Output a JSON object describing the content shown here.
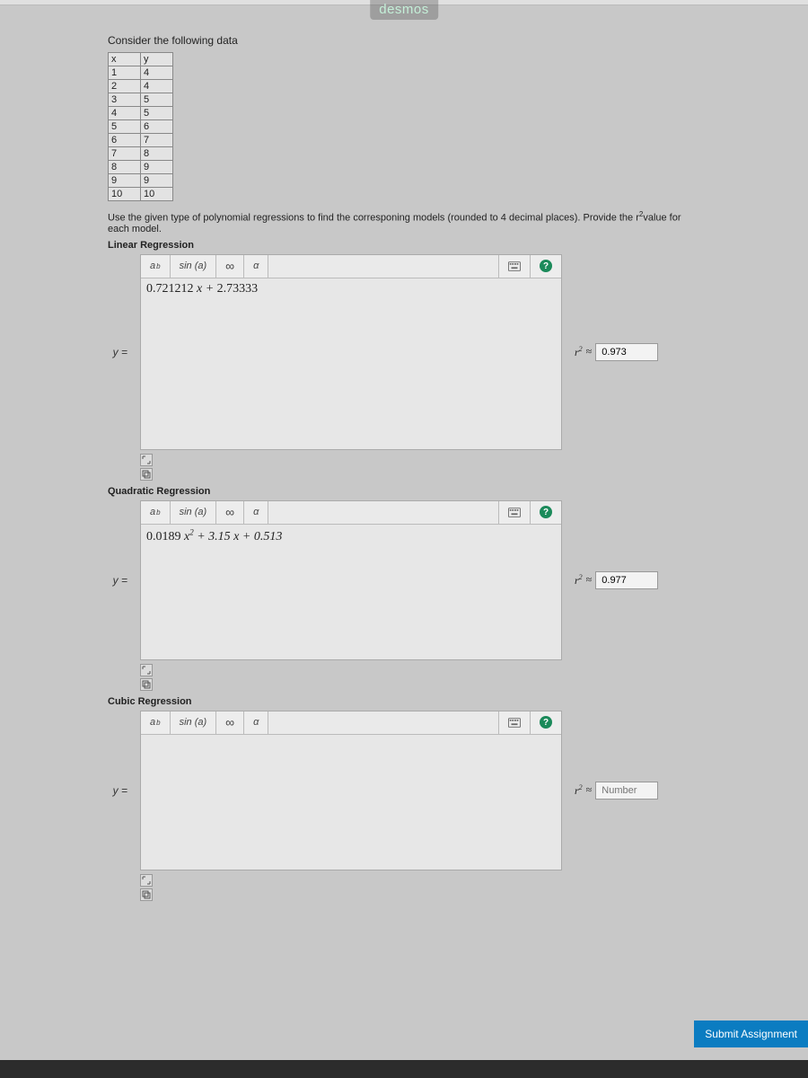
{
  "header": {
    "desmos": "desmos"
  },
  "prompt": "Consider the following data",
  "table": {
    "headers": [
      "x",
      "y"
    ],
    "rows": [
      [
        "1",
        "4"
      ],
      [
        "2",
        "4"
      ],
      [
        "3",
        "5"
      ],
      [
        "4",
        "5"
      ],
      [
        "5",
        "6"
      ],
      [
        "6",
        "7"
      ],
      [
        "7",
        "8"
      ],
      [
        "8",
        "9"
      ],
      [
        "9",
        "9"
      ],
      [
        "10",
        "10"
      ]
    ]
  },
  "instructions_pre": "Use the given type of polynomial regressions to find the corresponing models (rounded to 4 decimal places). Provide the r",
  "instructions_sup": "2",
  "instructions_post": "value for each model.",
  "toolbar": {
    "ab_a": "a",
    "ab_b": "b",
    "sin": "sin (a)",
    "inf": "∞",
    "alpha": "α",
    "help": "?"
  },
  "y_equals": "y =",
  "r2_label_r": "r",
  "r2_label_sup": "2",
  "r2_approx": "≈",
  "sections": {
    "linear": {
      "title": "Linear Regression",
      "expr_a": "0.721212",
      "expr_mid": " x + ",
      "expr_b": "2.73333",
      "r2": "0.973"
    },
    "quadratic": {
      "title": "Quadratic Regression",
      "expr_a": "0.0189",
      "expr_mid1": " x",
      "expr_sup": "2",
      "expr_mid2": " + 3.15 x + 0.513",
      "r2": "0.977"
    },
    "cubic": {
      "title": "Cubic Regression",
      "r2_placeholder": "Number"
    }
  },
  "submit": "Submit Assignment"
}
